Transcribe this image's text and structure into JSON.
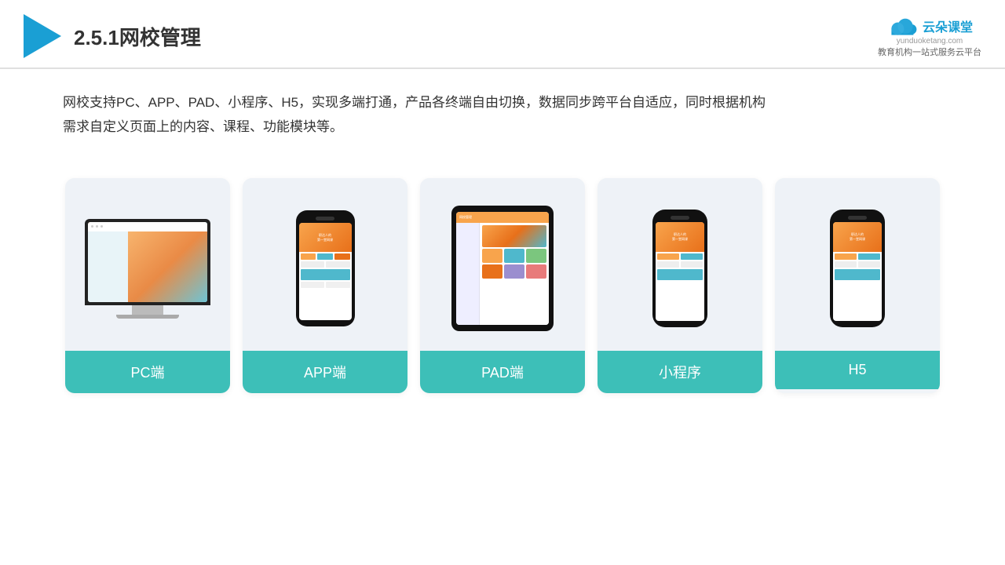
{
  "header": {
    "title": "2.5.1网校管理",
    "brand": {
      "name": "云朵课堂",
      "url": "yunduoketang.com",
      "tagline": "教育机构一站\n式服务云平台"
    }
  },
  "description": {
    "text": "网校支持PC、APP、PAD、小程序、H5，实现多端打通，产品各终端自由切换，数据同步跨平台自适应，同时根据机构需求自定义页面上的内容、课程、功能模块等。"
  },
  "cards": [
    {
      "id": "pc",
      "label": "PC端"
    },
    {
      "id": "app",
      "label": "APP端"
    },
    {
      "id": "pad",
      "label": "PAD端"
    },
    {
      "id": "miniprogram",
      "label": "小程序"
    },
    {
      "id": "h5",
      "label": "H5"
    }
  ],
  "colors": {
    "accent": "#3dbfb8",
    "header_border": "#e0e0e0",
    "brand_color": "#1a9fd4",
    "card_bg": "#eef2f7",
    "card_label_bg": "#3dbfb8"
  }
}
